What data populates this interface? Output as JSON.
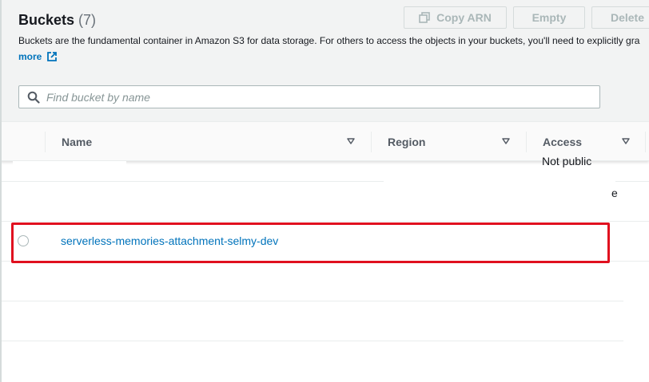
{
  "header": {
    "title": "Buckets",
    "count": "(7)",
    "description": "Buckets are the fundamental container in Amazon S3 for data storage. For others to access the objects in your buckets, you'll need to explicitly gra",
    "learn_more": "more"
  },
  "actions": {
    "copy_arn": "Copy ARN",
    "empty": "Empty",
    "delete": "Delete"
  },
  "search": {
    "placeholder": "Find bucket by name"
  },
  "table": {
    "columns": [
      "Name",
      "Region",
      "Access"
    ],
    "rows": [
      {
        "access_fragment": "Not public"
      },
      {
        "access_fragment": "e"
      },
      {
        "name": "serverless-memories-attachment-selmy-dev"
      }
    ]
  },
  "colors": {
    "link": "#0073bb",
    "highlight": "#e0101f",
    "header_bg": "#f2f3f3"
  }
}
